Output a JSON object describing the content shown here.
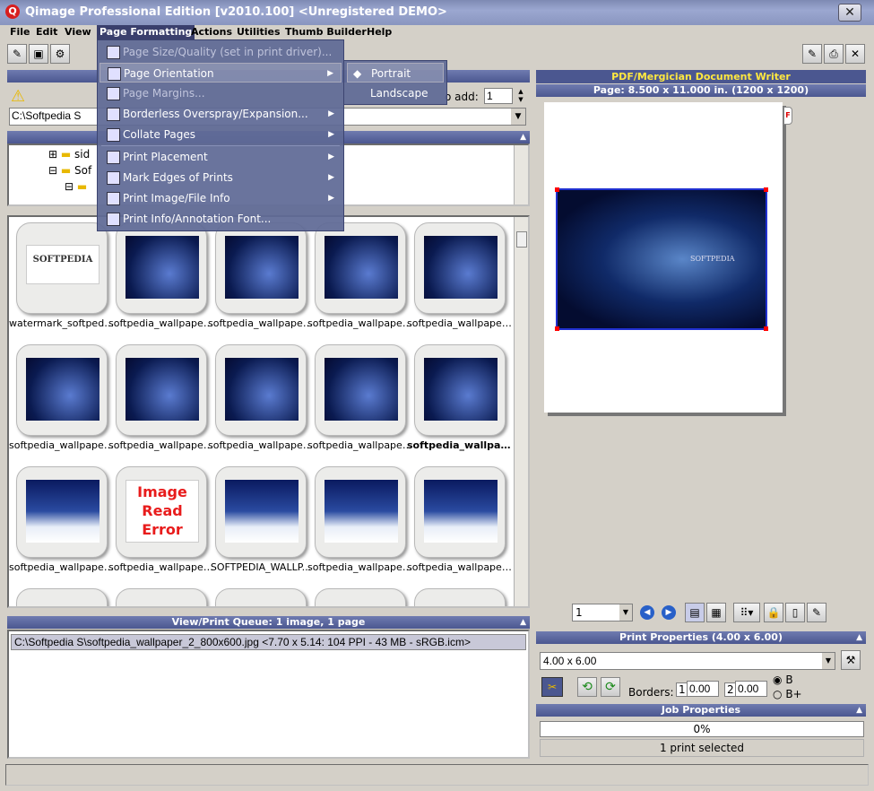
{
  "window": {
    "title": "Qimage Professional Edition [v2010.100] <Unregistered DEMO>"
  },
  "menu": [
    "File",
    "Edit",
    "View",
    "Page Formatting",
    "Actions",
    "Utilities",
    "Thumb Builder",
    "Help"
  ],
  "page_formatting_menu": {
    "items": [
      {
        "label": "Page Size/Quality (set in print driver)...",
        "disabled": true,
        "icon": "page-size-icon"
      },
      {
        "label": "Page Orientation",
        "submenu": true,
        "highlighted": true,
        "icon": "orientation-icon"
      },
      {
        "label": "Page Margins...",
        "disabled": true,
        "icon": "margins-icon"
      },
      {
        "label": "Borderless Overspray/Expansion...",
        "submenu": true,
        "icon": "borderless-icon"
      },
      {
        "label": "Collate Pages",
        "submenu": true,
        "icon": "collate-icon"
      },
      {
        "label": "Print Placement",
        "submenu": true,
        "icon": "placement-icon"
      },
      {
        "label": "Mark Edges of Prints",
        "submenu": true,
        "icon": "mark-edges-icon"
      },
      {
        "label": "Print Image/File Info",
        "submenu": true,
        "icon": "info-icon"
      },
      {
        "label": "Print Info/Annotation Font...",
        "icon": "font-icon"
      }
    ],
    "orientation_submenu": [
      "Portrait",
      "Landscape"
    ]
  },
  "left_panel": {
    "path": "C:\\Softpedia S",
    "to_add_label": "o add:",
    "to_add_value": "1",
    "tree": [
      "sid",
      "Sof"
    ]
  },
  "thumbnails": [
    {
      "caption": "watermark_softpedi...",
      "kind": "white-logo",
      "logo": "SOFTPEDIA"
    },
    {
      "caption": "softpedia_wallpaper...",
      "kind": "blue"
    },
    {
      "caption": "softpedia_wallpaper...",
      "kind": "blue"
    },
    {
      "caption": "softpedia_wallpaper...",
      "kind": "blue"
    },
    {
      "caption": "softpedia_wallpaper...",
      "kind": "blue"
    },
    {
      "caption": "softpedia_wallpaper...",
      "kind": "blue"
    },
    {
      "caption": "softpedia_wallpaper...",
      "kind": "blue"
    },
    {
      "caption": "softpedia_wallpaper...",
      "kind": "blue"
    },
    {
      "caption": "softpedia_wallpaper...",
      "kind": "blue"
    },
    {
      "caption": "softpedia_wallpap...",
      "kind": "blue",
      "bold": true
    },
    {
      "caption": "softpedia_wallpaper...",
      "kind": "photo"
    },
    {
      "caption": "softpedia_wallpaper...",
      "kind": "error",
      "error_text": [
        "Image",
        "Read",
        "Error"
      ]
    },
    {
      "caption": "SOFTPEDIA_WALLP...",
      "kind": "photo"
    },
    {
      "caption": "softpedia_wallpaper...",
      "kind": "photo"
    },
    {
      "caption": "softpedia_wallpaper...",
      "kind": "photo"
    }
  ],
  "queue": {
    "header": "View/Print Queue: 1 image, 1 page",
    "item": "C:\\Softpedia S\\softpedia_wallpaper_2_800x600.jpg <7.70 x 5.14:  104 PPI -  43 MB - sRGB.icm>"
  },
  "printer": {
    "name": "PDF/Mergician Document Writer",
    "page_info": "Page: 8.500 x 11.000 in.  (1200 x 1200)",
    "page_number": "1",
    "flag": "F",
    "preview_text": "SOFTPEDIA"
  },
  "print_properties": {
    "header": "Print Properties (4.00 x 6.00)",
    "size": "4.00 x 6.00",
    "borders_label": "Borders:",
    "border1_idx": "1",
    "border1_val": "0.00",
    "border2_idx": "2",
    "border2_val": "0.00",
    "radio_b": "B",
    "radio_bplus": "B+"
  },
  "job_properties": {
    "header": "Job Properties",
    "progress_text": "0%",
    "progress": 0,
    "status": "1 print selected"
  },
  "colors": {
    "header_bg": "#4b5790",
    "menu_bg": "#5f6996",
    "accent_blue": "#0a1a50"
  }
}
